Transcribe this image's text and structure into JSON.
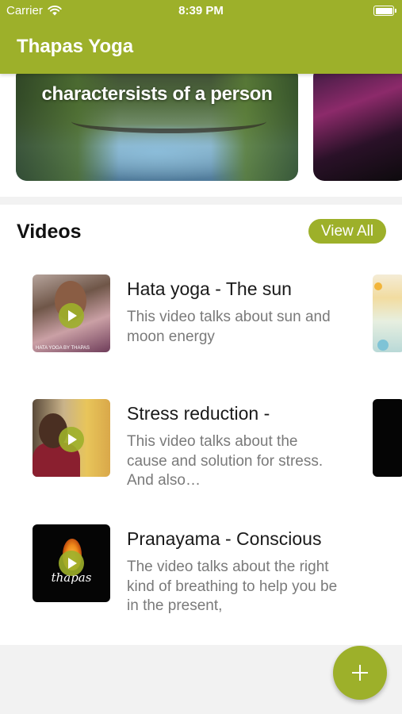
{
  "status_bar": {
    "carrier": "Carrier",
    "time": "8:39 PM",
    "icons": [
      "wifi-icon",
      "battery-icon"
    ]
  },
  "header": {
    "title": "Thapas Yoga",
    "color": "#9db02a"
  },
  "carousel": {
    "banners": [
      {
        "text": "charactersists of a person"
      },
      {
        "text": ""
      }
    ]
  },
  "videos": {
    "section_title": "Videos",
    "view_all_label": "View All",
    "items": [
      {
        "title": "Hata yoga - The sun",
        "description": "This video talks about sun and moon energy",
        "thumb_caption": "HATA YOGA BY THAPAS"
      },
      {
        "title": "Stress reduction -",
        "description": "This video talks about the cause and solution for stress. And also…"
      },
      {
        "title": "Pranayama - Conscious",
        "description": "The video talks about the right kind of breathing to help you be in the present,",
        "thumb_logo": "thapas"
      }
    ]
  },
  "fab": {
    "icon": "plus-icon"
  }
}
